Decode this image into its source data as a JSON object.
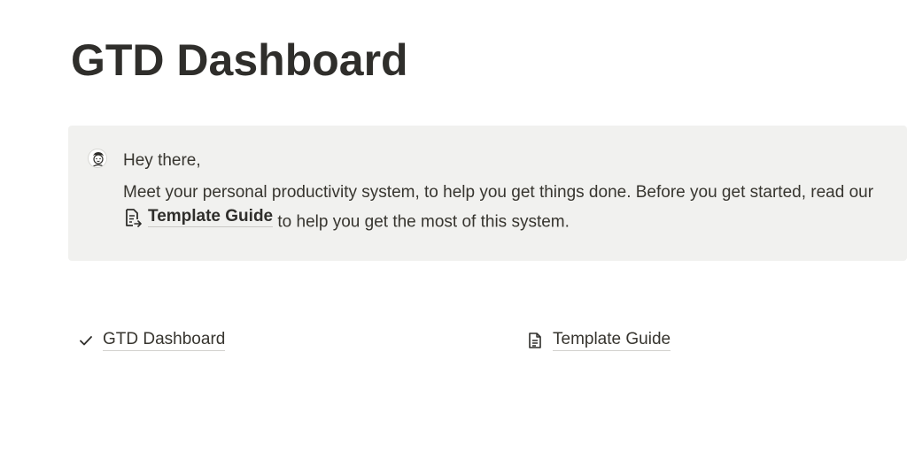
{
  "page": {
    "title": "GTD Dashboard"
  },
  "callout": {
    "avatar_icon": "person-avatar-icon",
    "greeting": "Hey there,",
    "body_part1": "Meet your personal productivity system, to help you get things done. Before you get started, read our ",
    "link_icon": "document-icon",
    "link_label": "Template Guide",
    "body_part2": " to help you get the most of this system.",
    "background": "#f1f1ef"
  },
  "links": [
    {
      "icon": "checkmark-icon",
      "label": "GTD Dashboard"
    },
    {
      "icon": "document-icon",
      "label": "Template Guide"
    }
  ]
}
